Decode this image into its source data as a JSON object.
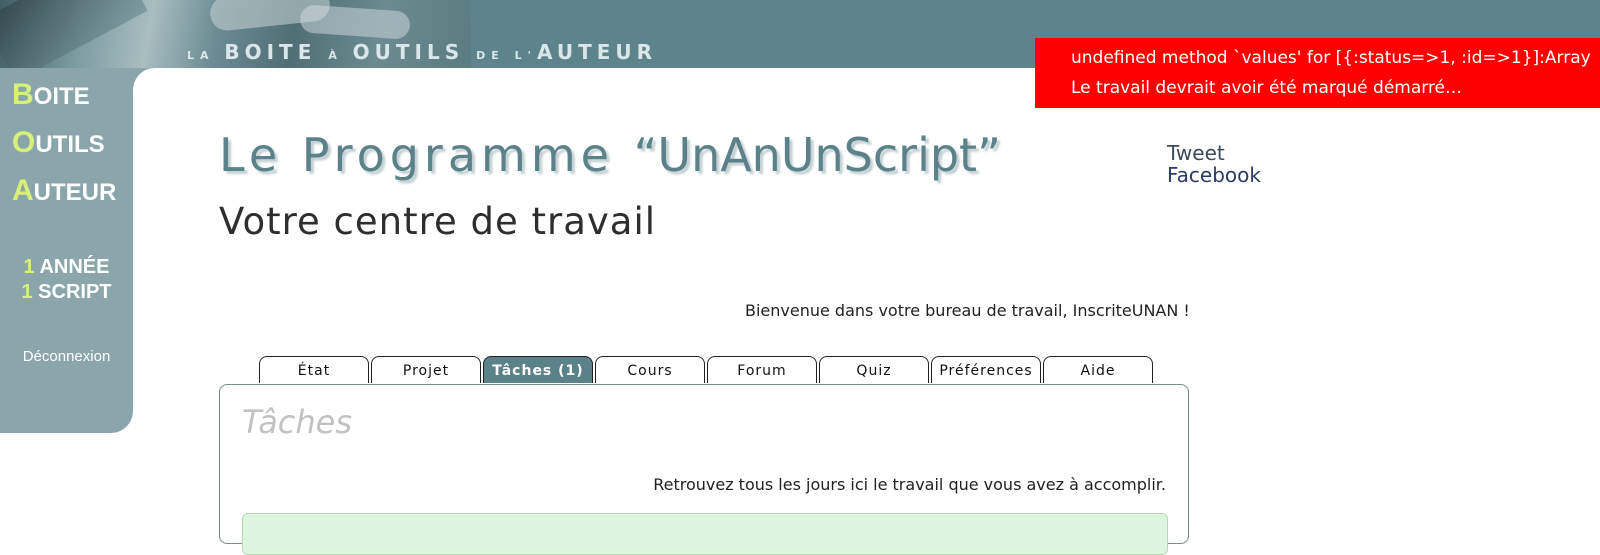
{
  "banner": {
    "title_parts": [
      {
        "text": "LA ",
        "size": "s"
      },
      {
        "text": "BOITE ",
        "size": "b"
      },
      {
        "text": "À ",
        "size": "s"
      },
      {
        "text": "OUTILS ",
        "size": "b"
      },
      {
        "text": "DE L'",
        "size": "s"
      },
      {
        "text": "AUTEUR",
        "size": "b"
      }
    ]
  },
  "errors": [
    "undefined method `values' for [{:status=>1, :id=>1}]:Array",
    "Le travail devrait avoir été marqué démarré…"
  ],
  "sidebar": {
    "brand": [
      {
        "initial": "B",
        "rest": "OITE"
      },
      {
        "initial": "O",
        "rest": "UTILS"
      },
      {
        "initial": "A",
        "rest": "UTEUR"
      }
    ],
    "program": [
      {
        "num": "1",
        "label": "ANNÉE"
      },
      {
        "num": "1",
        "label": "SCRIPT"
      }
    ],
    "logout": "Déconnexion"
  },
  "main": {
    "title_prefix": "Le Programme ",
    "title_name": "“UnAnUnScript”",
    "subtitle": "Votre centre de travail",
    "welcome": "Bienvenue dans votre bureau de travail, InscriteUNAN !"
  },
  "social": {
    "tweet": "Tweet",
    "facebook": "Facebook"
  },
  "tabs": [
    {
      "label": "État",
      "active": false
    },
    {
      "label": "Projet",
      "active": false
    },
    {
      "label": "Tâches (1)",
      "active": true
    },
    {
      "label": "Cours",
      "active": false
    },
    {
      "label": "Forum",
      "active": false
    },
    {
      "label": "Quiz",
      "active": false
    },
    {
      "label": "Préférences",
      "active": false
    },
    {
      "label": "Aide",
      "active": false
    }
  ],
  "panel": {
    "title": "Tâches",
    "description": "Retrouvez tous les jours ici le travail que vous avez à accomplir."
  },
  "colors": {
    "header": "#5c848a",
    "sidebar": "#8aa6aa",
    "accent": "#d8f07a",
    "error": "#ff0000",
    "active_tab": "#5b8289"
  }
}
